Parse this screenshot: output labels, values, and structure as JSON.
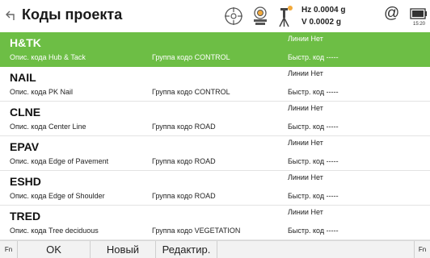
{
  "header": {
    "title": "Коды проекта",
    "hz": "Hz 0.0004 g",
    "v": "V 0.0002 g",
    "at_symbol": "@",
    "clock": "15:20",
    "icons": [
      "back-arrow-icon",
      "target-icon",
      "instrument-icon",
      "antenna-icon",
      "at-icon",
      "battery-icon"
    ]
  },
  "labels": {
    "desc": "Опис. кода",
    "group": "Группа кодо",
    "quick": "Быстр. код",
    "lines": "Линии"
  },
  "rows": [
    {
      "code": "H&TK",
      "desc": "Hub & Tack",
      "group": "CONTROL",
      "lines": "Нет",
      "quick": "-----",
      "selected": true
    },
    {
      "code": "NAIL",
      "desc": "PK Nail",
      "group": "CONTROL",
      "lines": "Нет",
      "quick": "-----",
      "selected": false
    },
    {
      "code": "CLNE",
      "desc": "Center Line",
      "group": "ROAD",
      "lines": "Нет",
      "quick": "-----",
      "selected": false
    },
    {
      "code": "EPAV",
      "desc": "Edge of Pavement",
      "group": "ROAD",
      "lines": "Нет",
      "quick": "-----",
      "selected": false
    },
    {
      "code": "ESHD",
      "desc": "Edge of Shoulder",
      "group": "ROAD",
      "lines": "Нет",
      "quick": "-----",
      "selected": false
    },
    {
      "code": "TRED",
      "desc": "Tree deciduous",
      "group": "VEGETATION",
      "lines": "Нет",
      "quick": "-----",
      "selected": false
    }
  ],
  "footer": {
    "fn_left": "Fn",
    "ok": "OK",
    "new": "Новый",
    "edit": "Редактир.",
    "fn_right": "Fn"
  },
  "colors": {
    "selected_row": "#6dbe45",
    "footer_bg": "#f2f2f2"
  }
}
